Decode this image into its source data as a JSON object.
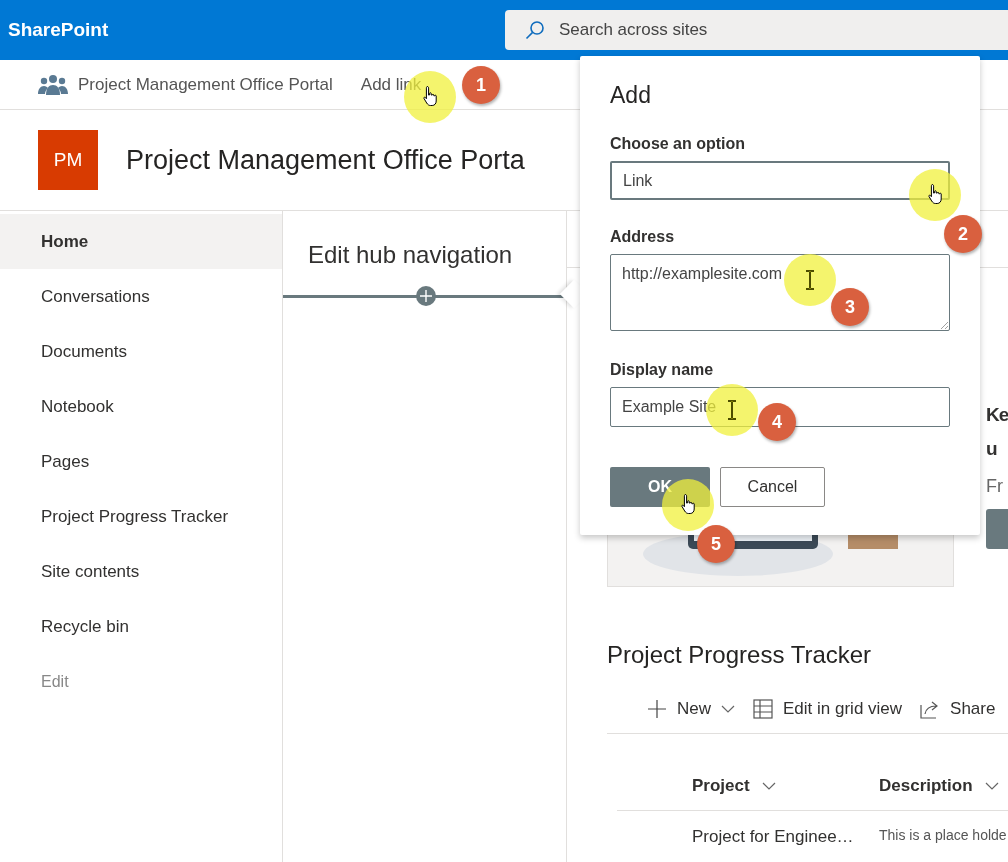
{
  "app": {
    "name": "SharePoint"
  },
  "search": {
    "placeholder": "Search across sites"
  },
  "hub_nav": {
    "site": "Project Management Office Portal",
    "add_link": "Add link"
  },
  "site_header": {
    "logo": "PM",
    "title": "Project Management Office Porta"
  },
  "sidebar": {
    "items": [
      {
        "label": "Home",
        "selected": true,
        "disabled": false
      },
      {
        "label": "Conversations",
        "selected": false,
        "disabled": false
      },
      {
        "label": "Documents",
        "selected": false,
        "disabled": false
      },
      {
        "label": "Notebook",
        "selected": false,
        "disabled": false
      },
      {
        "label": "Pages",
        "selected": false,
        "disabled": false
      },
      {
        "label": "Project Progress Tracker",
        "selected": false,
        "disabled": false
      },
      {
        "label": "Site contents",
        "selected": false,
        "disabled": false
      },
      {
        "label": "Recycle bin",
        "selected": false,
        "disabled": false
      },
      {
        "label": "Edit",
        "selected": false,
        "disabled": true
      }
    ]
  },
  "hub_panel": {
    "title": "Edit hub navigation"
  },
  "hero": {
    "kind": "picture",
    "heading_lines": [
      "Ke",
      "u"
    ],
    "text": "Fr"
  },
  "list": {
    "title": "Project Progress Tracker",
    "toolbar": [
      {
        "label": "New",
        "kind": "plus",
        "dropdown": true
      },
      {
        "label": "Edit in grid view",
        "kind": "grid",
        "dropdown": false
      },
      {
        "label": "Share",
        "kind": "share",
        "dropdown": false
      }
    ],
    "columns": [
      "Project",
      "Description"
    ],
    "rows": [
      [
        "Project for Enginee…",
        "This is a place holde"
      ]
    ]
  },
  "dialog": {
    "title": "Add",
    "fields": [
      {
        "label": "Choose an option",
        "kind": "dropdown",
        "value": "Link"
      },
      {
        "label": "Address",
        "kind": "textarea",
        "value": "http://examplesite.com"
      },
      {
        "label": "Display name",
        "kind": "text",
        "value": "Example Site"
      }
    ],
    "buttons": [
      {
        "label": "OK",
        "primary": true
      },
      {
        "label": "Cancel",
        "primary": false
      }
    ]
  },
  "annotations": [
    {
      "number": "1",
      "kind": "hand"
    },
    {
      "number": "2",
      "kind": "hand"
    },
    {
      "number": "3",
      "kind": "ibeam"
    },
    {
      "number": "4",
      "kind": "ibeam"
    },
    {
      "number": "5",
      "kind": "hand"
    }
  ]
}
